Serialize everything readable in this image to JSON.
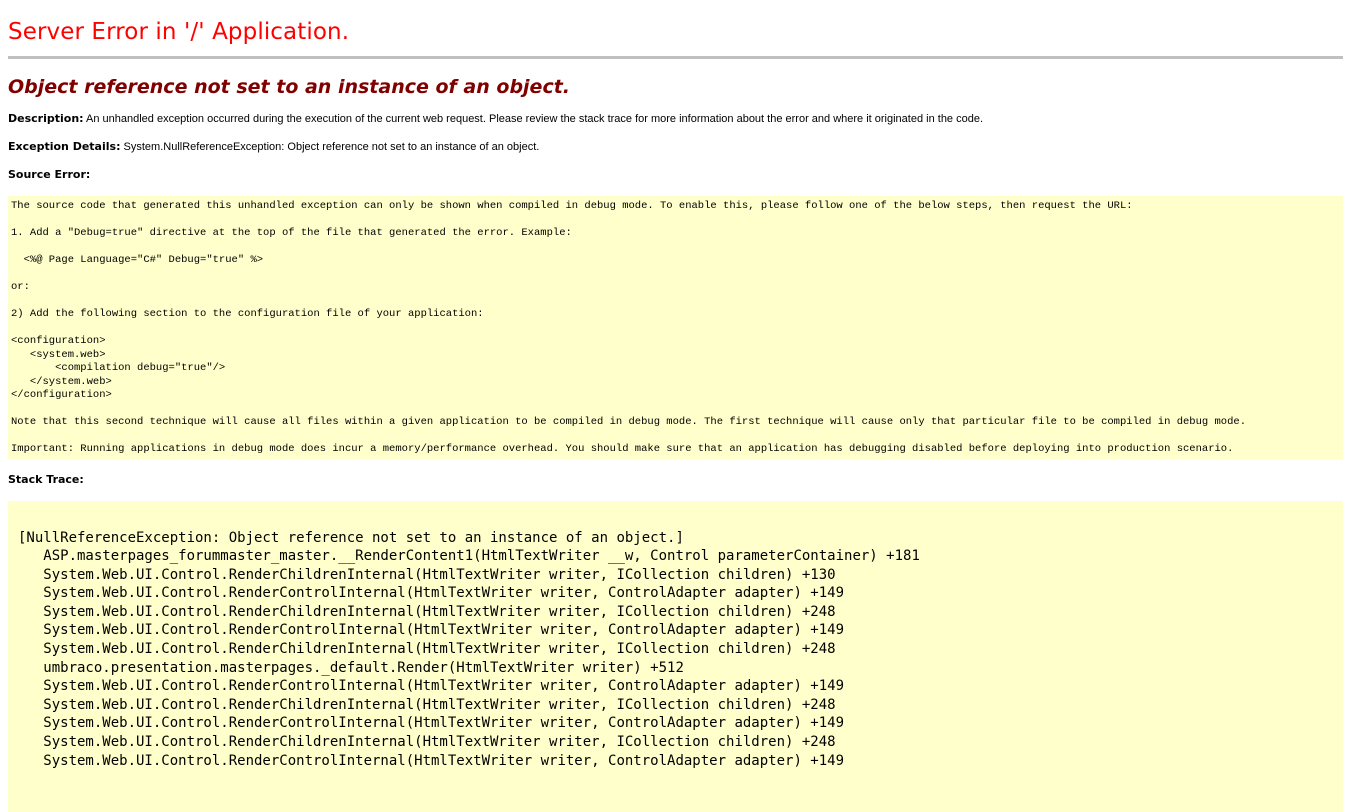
{
  "page": {
    "title": "Server Error in '/' Application.",
    "subtitle": "Object reference not set to an instance of an object.",
    "description_label": "Description:",
    "description_text": " An unhandled exception occurred during the execution of the current web request. Please review the stack trace for more information about the error and where it originated in the code.",
    "exception_label": "Exception Details:",
    "exception_text": " System.NullReferenceException: Object reference not set to an instance of an object.",
    "source_error_label": "Source Error:",
    "stack_trace_label": "Stack Trace:"
  },
  "source_error": {
    "line1": "The source code that generated this unhandled exception can only be shown when compiled in debug mode. To enable this, please follow one of the below steps, then request the URL:",
    "line2": "1. Add a \"Debug=true\" directive at the top of the file that generated the error. Example:",
    "line3": "  <%@ Page Language=\"C#\" Debug=\"true\" %>",
    "line4": "or:",
    "line5": "2) Add the following section to the configuration file of your application:",
    "line6": "<configuration>",
    "line7": "   <system.web>",
    "line8": "       <compilation debug=\"true\"/>",
    "line9": "   </system.web>",
    "line10": "</configuration>",
    "line11": "Note that this second technique will cause all files within a given application to be compiled in debug mode. The first technique will cause only that particular file to be compiled in debug mode.",
    "line12": "Important: Running applications in debug mode does incur a memory/performance overhead. You should make sure that an application has debugging disabled before deploying into production scenario."
  },
  "stack_trace": {
    "line1": "[NullReferenceException: Object reference not set to an instance of an object.]",
    "line2": "   ASP.masterpages_forummaster_master.__RenderContent1(HtmlTextWriter __w, Control parameterContainer) +181",
    "line3": "   System.Web.UI.Control.RenderChildrenInternal(HtmlTextWriter writer, ICollection children) +130",
    "line4": "   System.Web.UI.Control.RenderControlInternal(HtmlTextWriter writer, ControlAdapter adapter) +149",
    "line5": "   System.Web.UI.Control.RenderChildrenInternal(HtmlTextWriter writer, ICollection children) +248",
    "line6": "   System.Web.UI.Control.RenderControlInternal(HtmlTextWriter writer, ControlAdapter adapter) +149",
    "line7": "   System.Web.UI.Control.RenderChildrenInternal(HtmlTextWriter writer, ICollection children) +248",
    "line8": "   umbraco.presentation.masterpages._default.Render(HtmlTextWriter writer) +512",
    "line9": "   System.Web.UI.Control.RenderControlInternal(HtmlTextWriter writer, ControlAdapter adapter) +149",
    "line10": "   System.Web.UI.Control.RenderChildrenInternal(HtmlTextWriter writer, ICollection children) +248",
    "line11": "   System.Web.UI.Control.RenderControlInternal(HtmlTextWriter writer, ControlAdapter adapter) +149",
    "line12": "   System.Web.UI.Control.RenderChildrenInternal(HtmlTextWriter writer, ICollection children) +248",
    "line13": "   System.Web.UI.Control.RenderControlInternal(HtmlTextWriter writer, ControlAdapter adapter) +149"
  },
  "colors": {
    "title": "#ff0000",
    "subtitle": "#800000",
    "code_background": "#ffffcc",
    "rule": "#c0c0c0"
  }
}
